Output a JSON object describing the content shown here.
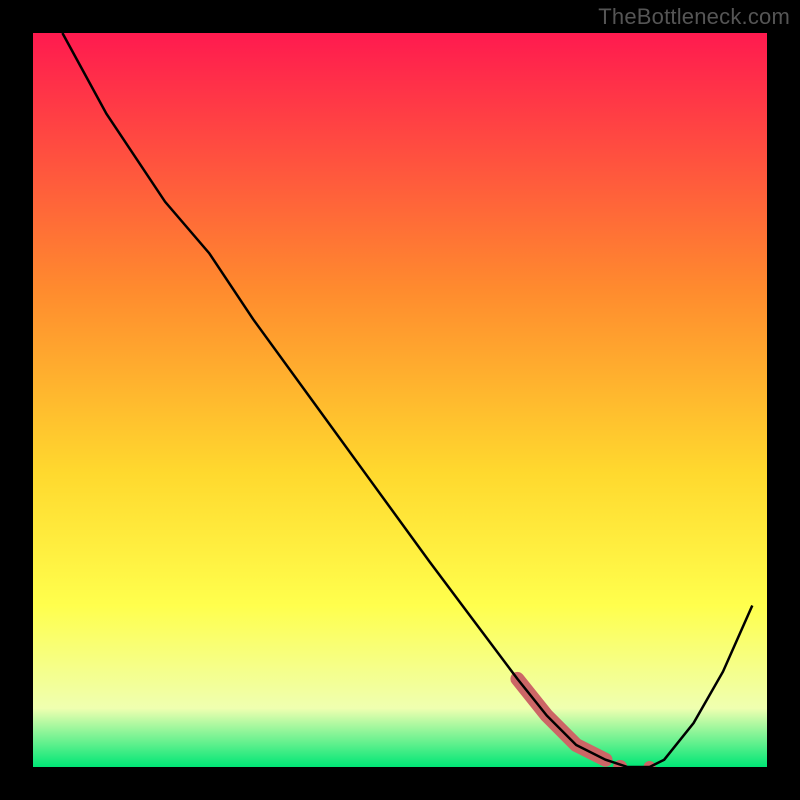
{
  "attribution": "TheBottleneck.com",
  "colors": {
    "curve": "#000000",
    "highlight": "#cc6666",
    "border": "#000000",
    "gradient_top": "#ff1a4f",
    "gradient_mid1": "#ff8b2e",
    "gradient_mid2": "#ffd92e",
    "gradient_mid3": "#ffff4d",
    "gradient_mid4": "#efffb0",
    "gradient_bottom": "#00e676"
  },
  "chart_data": {
    "type": "line",
    "title": "",
    "xlabel": "",
    "ylabel": "",
    "xlim": [
      0,
      100
    ],
    "ylim": [
      0,
      100
    ],
    "series": [
      {
        "name": "bottleneck-curve",
        "x": [
          4,
          10,
          18,
          24,
          30,
          38,
          46,
          54,
          60,
          66,
          70,
          74,
          78,
          81,
          84,
          86,
          90,
          94,
          98
        ],
        "values": [
          100,
          89,
          77,
          70,
          61,
          50,
          39,
          28,
          20,
          12,
          7,
          3,
          1,
          0,
          0,
          1,
          6,
          13,
          22
        ]
      },
      {
        "name": "optimal-range-highlight",
        "x": [
          66,
          70,
          74,
          78,
          80,
          82,
          84
        ],
        "values": [
          12,
          7,
          3,
          1,
          0,
          0,
          0
        ]
      }
    ],
    "annotations": []
  }
}
